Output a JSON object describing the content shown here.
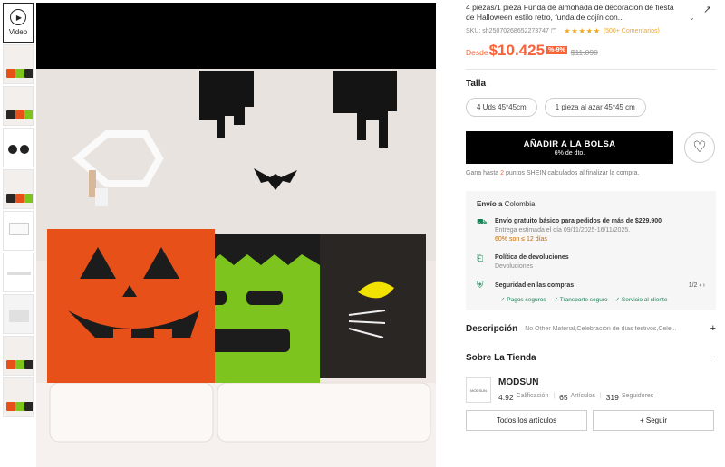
{
  "thumbnails": {
    "video_label": "Video",
    "items": [
      "thumb-1",
      "thumb-2",
      "thumb-3",
      "thumb-4",
      "thumb-5",
      "thumb-6",
      "thumb-7",
      "thumb-8",
      "thumb-9"
    ]
  },
  "product": {
    "title": "4 piezas/1 pieza Funda de almohada de decoración de fiesta de Halloween estilo retro, funda de cojín con...",
    "sku": "SKU: sh25070268652273747",
    "rating_stars": "★★★★★",
    "reviews": "(500+ Comentarios)",
    "price_prefix": "Desde",
    "price": "$10.425",
    "discount": "%-9%",
    "old_price": "$11.090"
  },
  "size": {
    "label": "Talla",
    "options": [
      "4 Uds 45*45cm",
      "1 pieza al azar 45*45 cm"
    ]
  },
  "cart": {
    "add_label": "AÑADIR A LA BOLSA",
    "add_sub": "6% de dto.",
    "points_pre": "Gana hasta",
    "points_num": "2",
    "points_post": "puntos SHEIN calculados al finalizar la compra."
  },
  "shipping": {
    "head": "Envío a",
    "country": "Colombia",
    "free_line": "Envío gratuito básico para pedidos de más de $229.900",
    "estimate": "Entrega estimada el día 09/11/2025-16/11/2025.",
    "percent": "60% son ≤ 12 días",
    "returns_title": "Política de devoluciones",
    "returns_sub": "Devoluciones",
    "secure_title": "Seguridad en las compras",
    "secure_pager": "1/2",
    "guarantees": [
      "✓ Pagos seguros",
      "✓ Transporte seguro",
      "✓ Servicio al cliente"
    ]
  },
  "description": {
    "title": "Descripción",
    "preview": "No Other Material,Celebración de días festivos,Cele..."
  },
  "store": {
    "section_title": "Sobre La Tienda",
    "name": "MODSUN",
    "logo_text": "MODSUN",
    "rating": "4.92",
    "rating_label": "Calificación",
    "articles": "65",
    "articles_label": "Artículos",
    "followers": "319",
    "followers_label": "Seguidores",
    "all_button": "Todos los artículos",
    "follow_button": "+ Seguir"
  },
  "colors": {
    "accent": "#fa6338",
    "pumpkin": "#e8501a",
    "frank": "#7dc41f",
    "cat": "#2a2624",
    "success": "#198055"
  }
}
